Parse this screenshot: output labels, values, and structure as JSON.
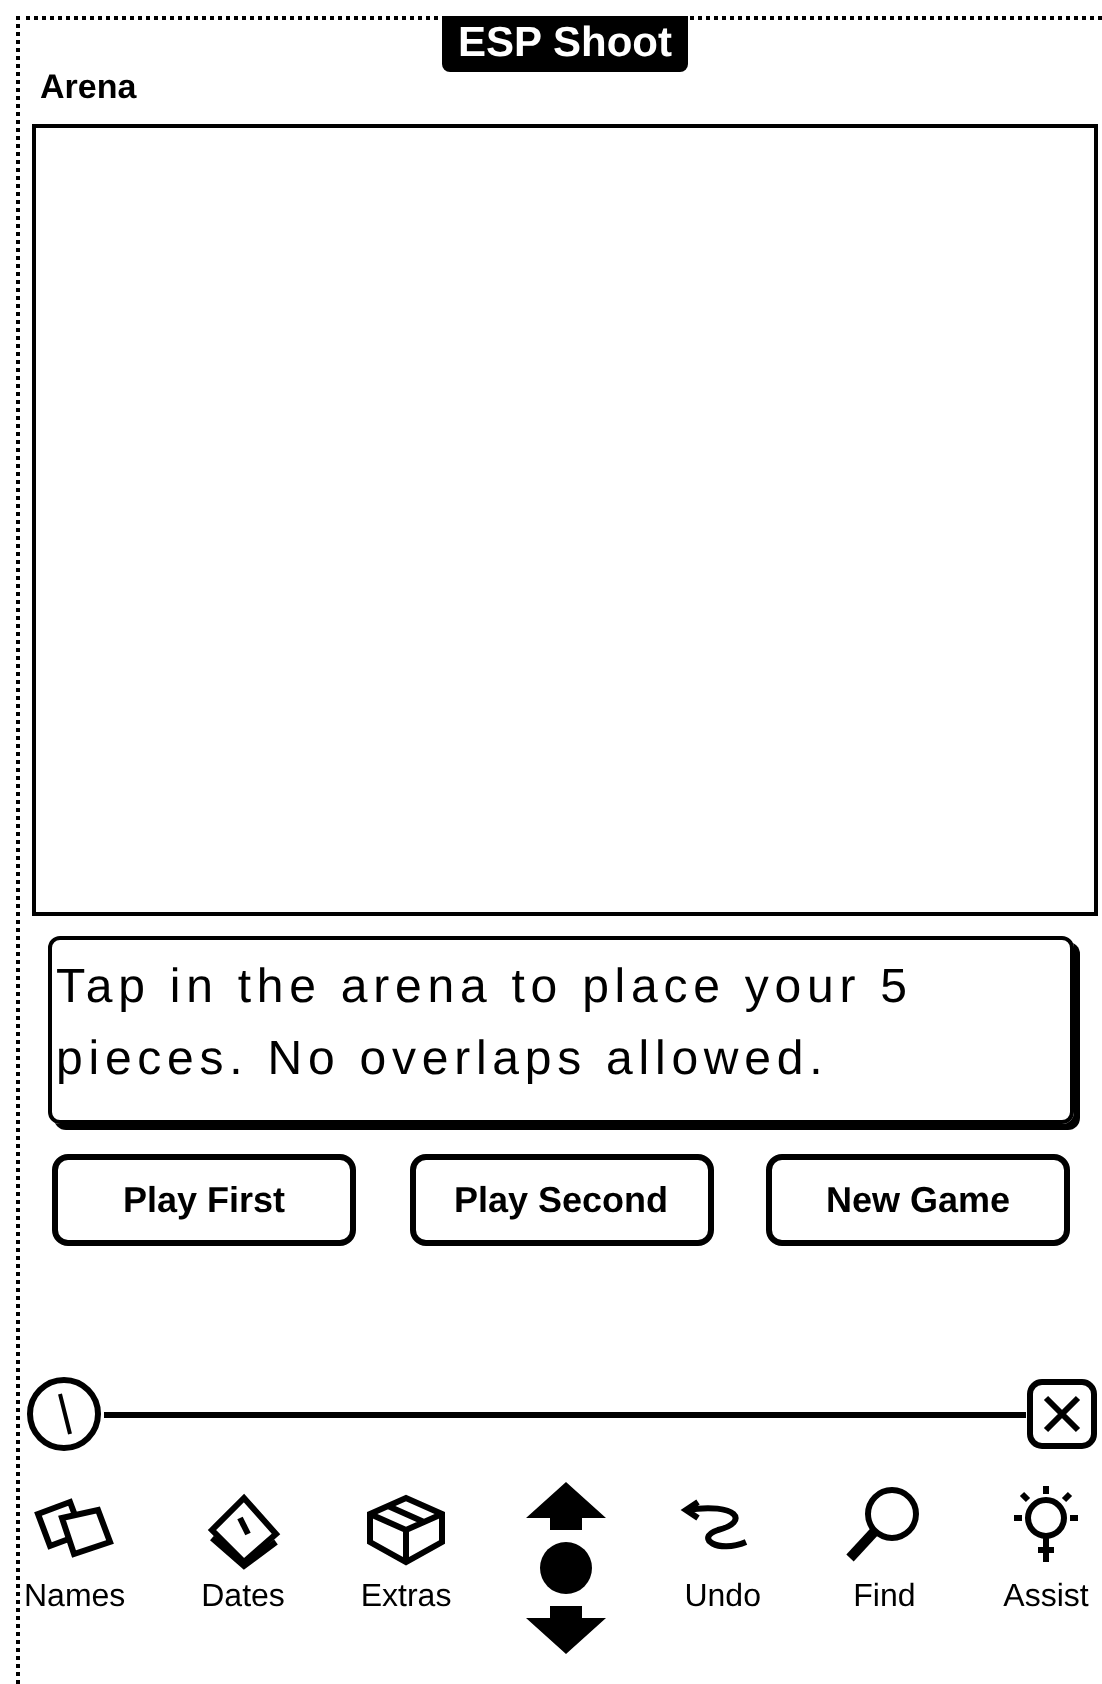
{
  "window": {
    "title": "ESP Shoot"
  },
  "arena": {
    "label": "Arena"
  },
  "message": "Tap in the arena to place your 5 pieces. No overlaps allowed.",
  "buttons": [
    "Play First",
    "Play Second",
    "New Game"
  ],
  "dock": [
    {
      "kind": "app",
      "label": "Names"
    },
    {
      "kind": "app",
      "label": "Dates"
    },
    {
      "kind": "app",
      "label": "Extras"
    },
    {
      "kind": "scroll"
    },
    {
      "kind": "app",
      "label": "Undo"
    },
    {
      "kind": "app",
      "label": "Find"
    },
    {
      "kind": "app",
      "label": "Assist"
    }
  ]
}
